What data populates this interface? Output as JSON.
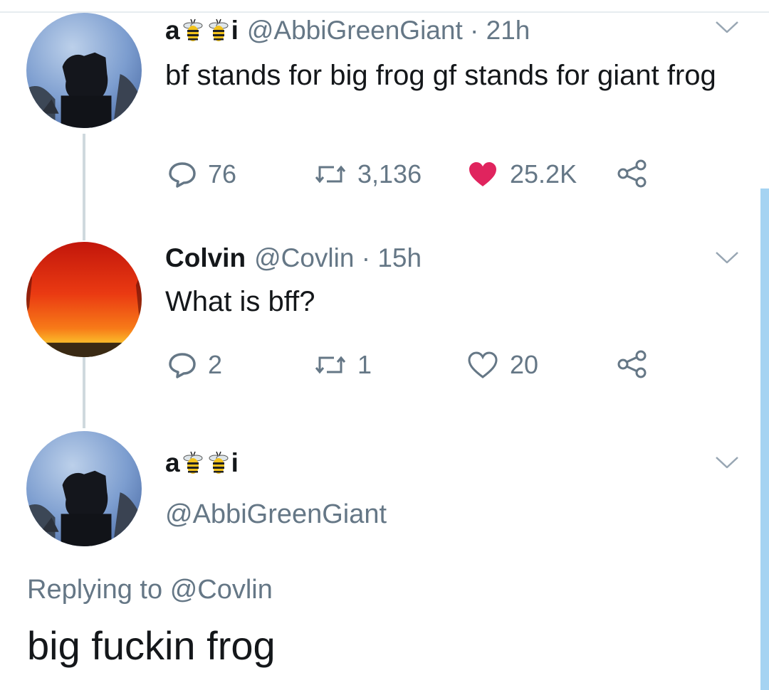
{
  "colors": {
    "text": "#14171a",
    "muted": "#657786",
    "like_active": "#e0245e",
    "thread_line": "#cfd9de",
    "scrollbar": "#a5d3f2"
  },
  "tweets": [
    {
      "display_name_start": "a",
      "display_name_end": "i",
      "display_name_icons": [
        "bee-icon",
        "bee-icon"
      ],
      "handle": "@AbbiGreenGiant",
      "time": "21h",
      "text": "bf stands for big frog gf stands for giant frog",
      "actions": {
        "replies": "76",
        "retweets": "3,136",
        "likes": "25.2K",
        "liked": true
      }
    },
    {
      "display_name": "Colvin",
      "handle": "@Covlin",
      "time": "15h",
      "text": "What is bff?",
      "actions": {
        "replies": "2",
        "retweets": "1",
        "likes": "20",
        "liked": false
      }
    }
  ],
  "focused_tweet": {
    "display_name_start": "a",
    "display_name_end": "i",
    "handle": "@AbbiGreenGiant",
    "replying_prefix": "Replying to",
    "replying_to": "@Covlin",
    "text": "big fuckin frog"
  },
  "separator": "·"
}
